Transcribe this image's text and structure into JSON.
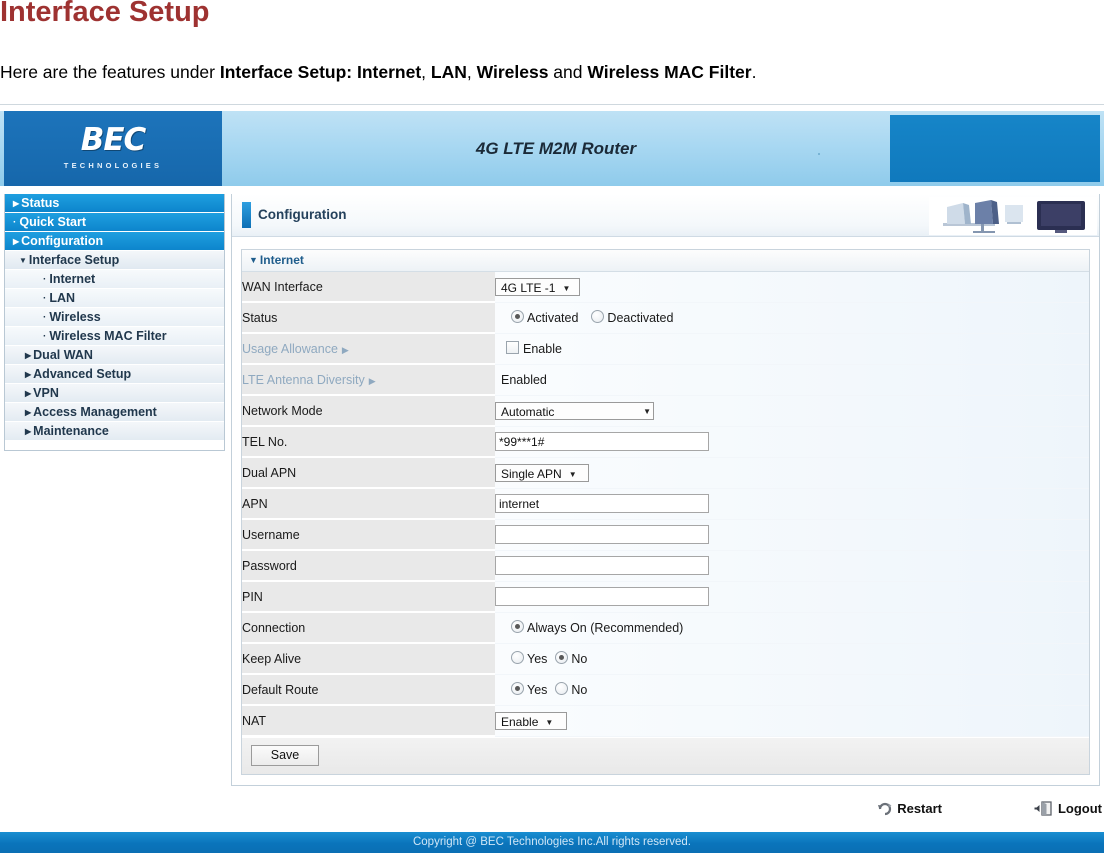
{
  "document": {
    "title": "Interface Setup",
    "intro_prefix": "Here are the features under ",
    "intro_b1": "Interface Setup: Internet",
    "intro_sep1": ", ",
    "intro_b2": "LAN",
    "intro_sep2": ", ",
    "intro_b3": "Wireless",
    "intro_sep3": " and ",
    "intro_b4": "Wireless MAC Filter",
    "intro_end": "."
  },
  "banner": {
    "logo_text": "BEC",
    "logo_sub": "TECHNOLOGIES",
    "product_title": "4G LTE M2M Router"
  },
  "sidebar": {
    "items": [
      {
        "label": "Status",
        "level": 0,
        "marker": "arrow"
      },
      {
        "label": "Quick Start",
        "level": 0,
        "marker": "dot"
      },
      {
        "label": "Configuration",
        "level": 0,
        "marker": "arrow"
      },
      {
        "label": "Interface Setup",
        "level": 1,
        "marker": "down"
      },
      {
        "label": "Internet",
        "level": 2,
        "marker": "dot"
      },
      {
        "label": "LAN",
        "level": 2,
        "marker": "dot"
      },
      {
        "label": "Wireless",
        "level": 2,
        "marker": "dot"
      },
      {
        "label": "Wireless MAC Filter",
        "level": 2,
        "marker": "dot"
      },
      {
        "label": "Dual WAN",
        "level": 1,
        "marker": "arrow"
      },
      {
        "label": "Advanced Setup",
        "level": 1,
        "marker": "arrow"
      },
      {
        "label": "VPN",
        "level": 1,
        "marker": "arrow"
      },
      {
        "label": "Access Management",
        "level": 1,
        "marker": "arrow"
      },
      {
        "label": "Maintenance",
        "level": 1,
        "marker": "arrow"
      }
    ]
  },
  "content": {
    "page_header": "Configuration",
    "section_title": "Internet",
    "rows": {
      "wan_interface": {
        "label": "WAN Interface",
        "value": "4G LTE -1"
      },
      "status": {
        "label": "Status",
        "option_activated": "Activated",
        "option_deactivated": "Deactivated"
      },
      "usage_allowance": {
        "label": "Usage Allowance",
        "checkbox_label": "Enable"
      },
      "lte_antenna_diversity": {
        "label": "LTE Antenna Diversity",
        "value": "Enabled"
      },
      "network_mode": {
        "label": "Network Mode",
        "value": "Automatic"
      },
      "tel_no": {
        "label": "TEL No.",
        "value": "*99***1#"
      },
      "dual_apn": {
        "label": "Dual APN",
        "value": "Single APN"
      },
      "apn": {
        "label": "APN",
        "value": "internet"
      },
      "username": {
        "label": "Username",
        "value": ""
      },
      "password": {
        "label": "Password",
        "value": ""
      },
      "pin": {
        "label": "PIN",
        "value": ""
      },
      "connection": {
        "label": "Connection",
        "option_always_on": "Always On (Recommended)"
      },
      "keep_alive": {
        "label": "Keep Alive",
        "option_yes": "Yes",
        "option_no": "No"
      },
      "default_route": {
        "label": "Default Route",
        "option_yes": "Yes",
        "option_no": "No"
      },
      "nat": {
        "label": "NAT",
        "value": "Enable"
      }
    },
    "save_button": "Save"
  },
  "footer": {
    "restart": "Restart",
    "logout": "Logout",
    "copyright": "Copyright @ BEC Technologies Inc.All rights reserved."
  },
  "colors": {
    "heading": "#9e3231",
    "nav_active": "#0d85cc",
    "link": "#8fa9c0",
    "section_title": "#1f5d8c",
    "footer_bar": "#0a74bb"
  }
}
